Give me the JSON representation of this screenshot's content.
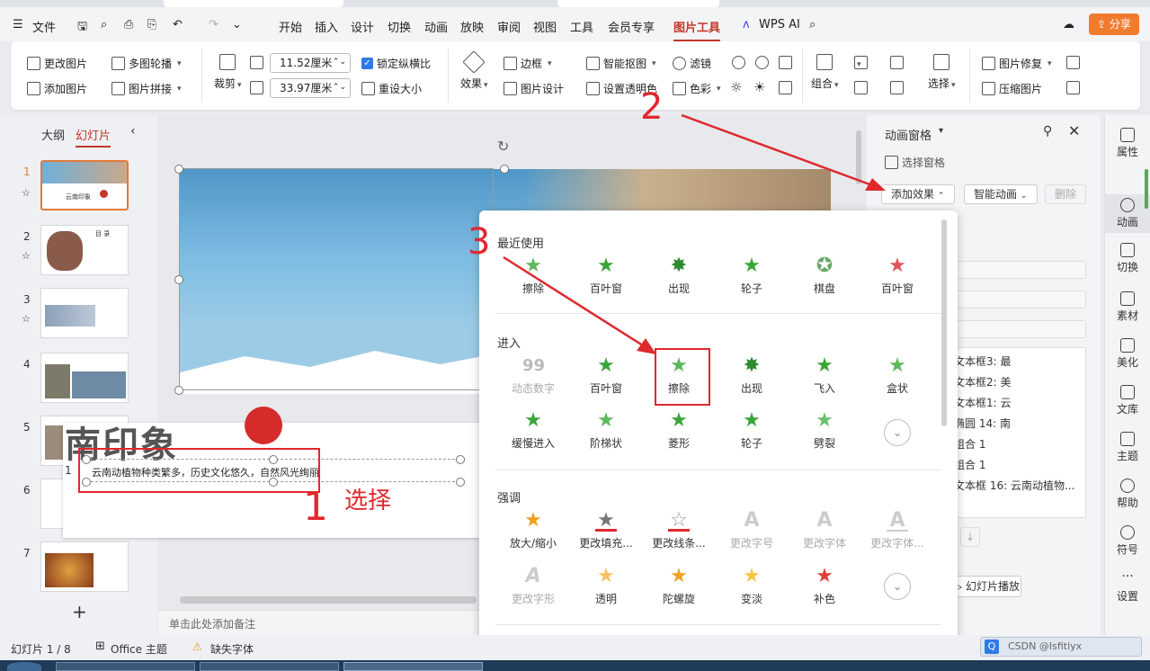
{
  "menubar": {
    "file": "文件",
    "tabs": [
      "开始",
      "插入",
      "设计",
      "切换",
      "动画",
      "放映",
      "审阅",
      "视图",
      "工具",
      "会员专享",
      "图片工具"
    ],
    "wps_ai": "WPS AI",
    "share": "分享"
  },
  "ribbon": {
    "change_picture": "更改图片",
    "multi_carousel": "多图轮播",
    "add_picture": "添加图片",
    "picture_stitch": "图片拼接",
    "crop": "裁剪",
    "width": "11.52厘米",
    "height": "33.97厘米",
    "lock_ratio": "锁定纵横比",
    "reset_size": "重设大小",
    "effects": "效果",
    "border": "边框",
    "picture_design": "图片设计",
    "smart_cutout": "智能抠图",
    "set_transparent": "设置透明色",
    "filter": "滤镜",
    "color": "色彩",
    "combine": "组合",
    "select": "选择",
    "picture_repair": "图片修复",
    "compress": "压缩图片"
  },
  "left_panel": {
    "outline_tab": "大纲",
    "slides_tab": "幻灯片",
    "slide_numbers": [
      "1",
      "2",
      "3",
      "4",
      "5",
      "6",
      "7"
    ],
    "thumb1_text": "云南印象",
    "thumb2_title": "目 录"
  },
  "canvas": {
    "slide_title_fragment": "南印象",
    "table_row_num": "1",
    "table_text": "云南动植物种类繁多，历史文化悠久，自然风光绚丽",
    "notes_placeholder": "单击此处添加备注"
  },
  "anim_panel": {
    "title": "动画窗格",
    "selection_pane": "选择窗格",
    "add_effect": "添加效果",
    "smart_anim": "智能动画",
    "delete": "删除",
    "items": [
      "文本框3: 最",
      "文本框2: 美",
      "文本框1: 云",
      "椭圆 14: 南",
      "组合 1",
      "组合 1",
      "文本框 16: 云南动植物..."
    ],
    "play": "幻灯片播放"
  },
  "sidebar": [
    "属性",
    "动画",
    "切换",
    "素材",
    "美化",
    "文库",
    "主题",
    "帮助",
    "符号",
    "设置"
  ],
  "dropdown": {
    "recent_label": "最近使用",
    "recent": [
      "擦除",
      "百叶窗",
      "出现",
      "轮子",
      "棋盘",
      "百叶窗"
    ],
    "enter_label": "进入",
    "enter_row1": [
      "动态数字",
      "百叶窗",
      "擦除",
      "出现",
      "飞入",
      "盒状"
    ],
    "enter_row2": [
      "缓慢进入",
      "阶梯状",
      "菱形",
      "轮子",
      "劈裂"
    ],
    "emph_label": "强调",
    "emph_row1": [
      "放大/缩小",
      "更改填充...",
      "更改线条...",
      "更改字号",
      "更改字体",
      "更改字体..."
    ],
    "emph_row2": [
      "更改字形",
      "透明",
      "陀螺旋",
      "变淡",
      "补色"
    ],
    "footer": "..."
  },
  "annotations": {
    "n1": "1",
    "select_label": "选择",
    "n2": "2",
    "n3": "3"
  },
  "status": {
    "slide_info": "幻灯片 1 / 8",
    "office_theme": "Office 主题",
    "missing_font": "缺失字体"
  },
  "watermark": "CSDN @Isfitlyx",
  "colors": {
    "accent": "#c0392b",
    "share": "#f07b2e",
    "star_green": "#3aa53a",
    "annotation": "#e0282e"
  }
}
